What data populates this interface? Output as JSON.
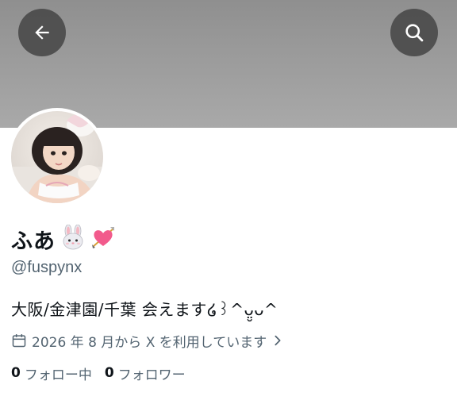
{
  "header": {
    "back_icon": "arrow-left-icon",
    "search_icon": "search-icon",
    "banner_color": "#9a9a9a",
    "button_color": "#4b4b4b"
  },
  "profile": {
    "display_name": "ふあ",
    "name_emojis": [
      "rabbit-face-emoji",
      "heart-with-arrow-emoji"
    ],
    "handle": "@fuspynx",
    "bio": "大阪/金津園/千葉 会えます໒꒱^ᴗ̤̮ᴗ^",
    "joined_icon": "calendar-icon",
    "joined": "2026 年 8 月から X を利用しています",
    "joined_chevron": "chevron-right-icon"
  },
  "stats": {
    "following_count": "0",
    "following_label": "フォロー中",
    "followers_count": "0",
    "followers_label": "フォロワー"
  },
  "colors": {
    "text_primary": "#0f1419",
    "text_secondary": "#536471"
  }
}
